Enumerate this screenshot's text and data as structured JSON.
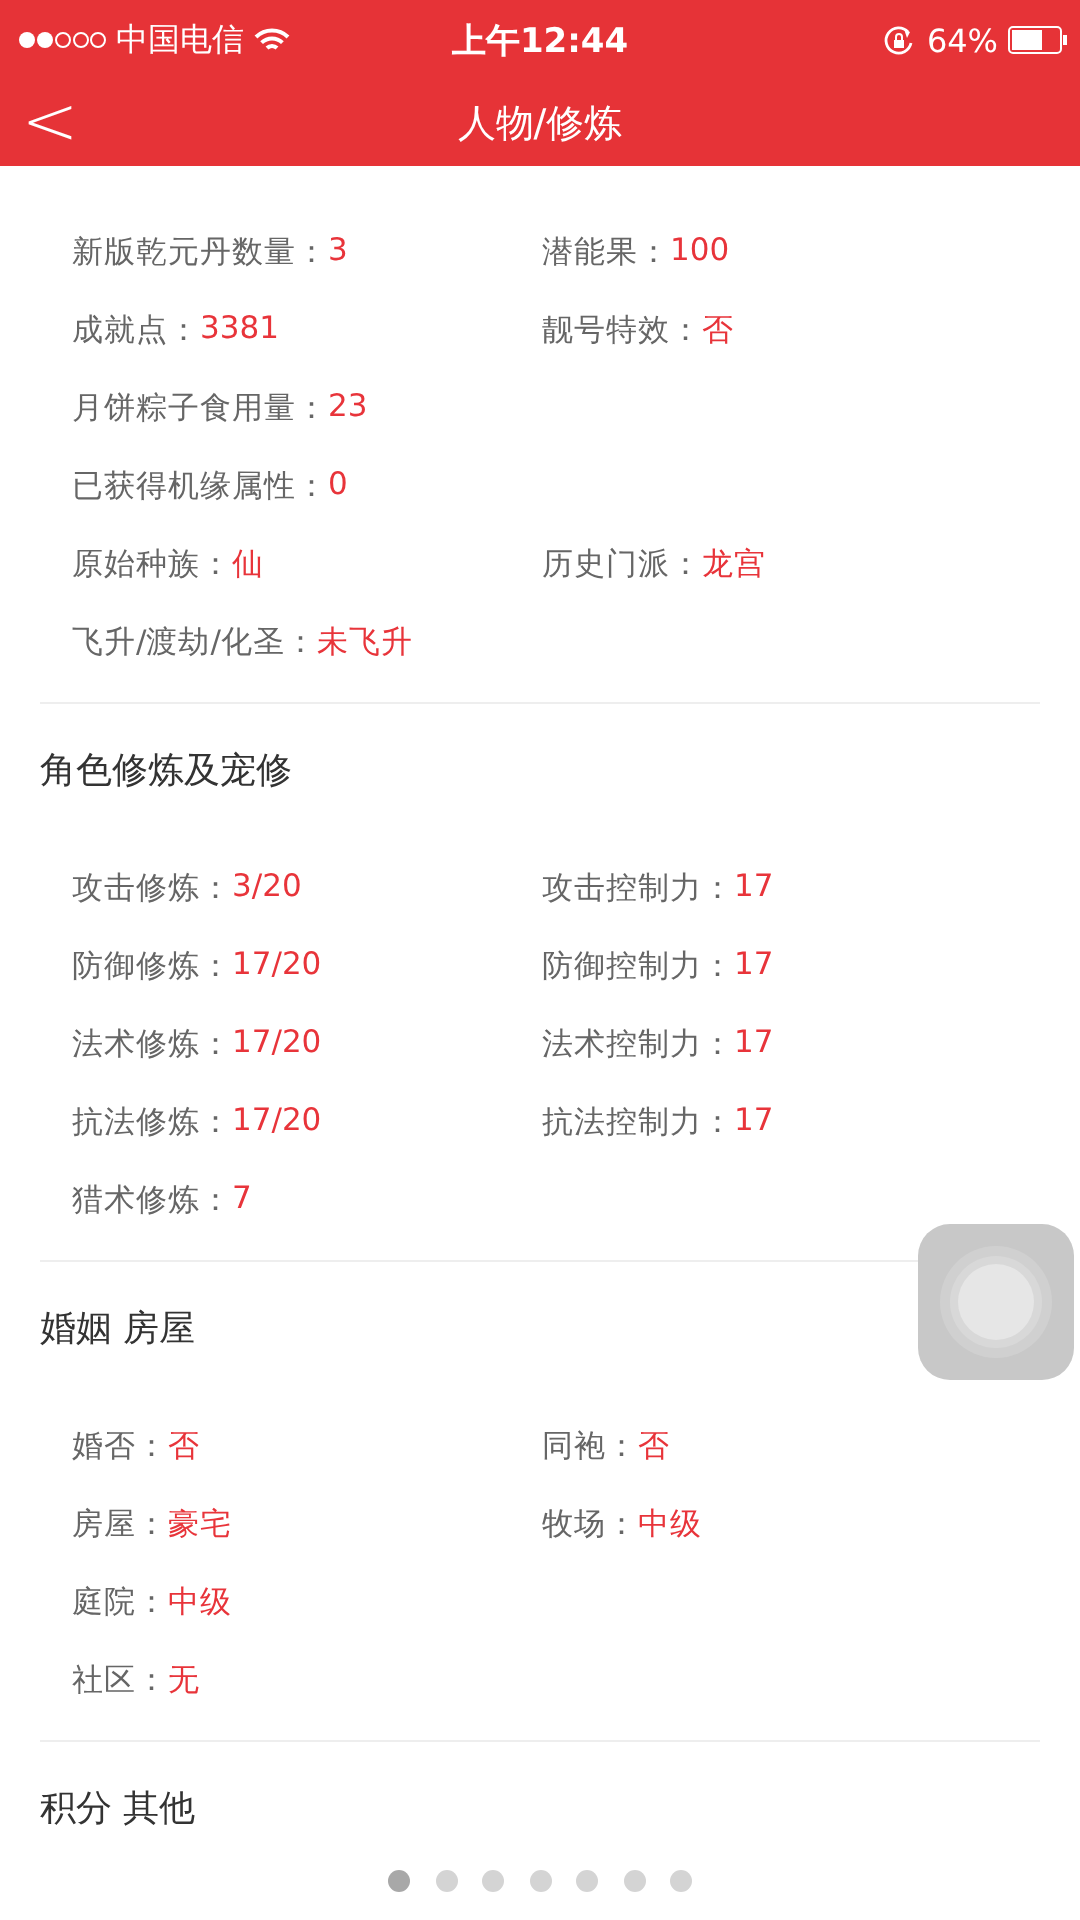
{
  "status_bar": {
    "carrier": "中国电信",
    "time": "上午12:44",
    "battery": "64%"
  },
  "nav": {
    "back": "<",
    "title": "人物/修炼"
  },
  "sections": [
    {
      "rows": [
        [
          {
            "label": "新版乾元丹数量：",
            "value": "3"
          },
          {
            "label": "潜能果：",
            "value": "100"
          }
        ],
        [
          {
            "label": "成就点：",
            "value": "3381"
          },
          {
            "label": "靓号特效：",
            "value": "否"
          }
        ],
        [
          {
            "label": "月饼粽子食用量：",
            "value": "23"
          }
        ],
        [
          {
            "label": "已获得机缘属性：",
            "value": "0"
          }
        ],
        [
          {
            "label": "原始种族：",
            "value": "仙"
          },
          {
            "label": "历史门派：",
            "value": "龙宫"
          }
        ],
        [
          {
            "label": "飞升/渡劫/化圣：",
            "value": "未飞升"
          }
        ]
      ]
    },
    {
      "title": "角色修炼及宠修",
      "rows": [
        [
          {
            "label": "攻击修炼：",
            "value": "3/20"
          },
          {
            "label": "攻击控制力：",
            "value": "17"
          }
        ],
        [
          {
            "label": "防御修炼：",
            "value": "17/20"
          },
          {
            "label": "防御控制力：",
            "value": "17"
          }
        ],
        [
          {
            "label": "法术修炼：",
            "value": "17/20"
          },
          {
            "label": "法术控制力：",
            "value": "17"
          }
        ],
        [
          {
            "label": "抗法修炼：",
            "value": "17/20"
          },
          {
            "label": "抗法控制力：",
            "value": "17"
          }
        ],
        [
          {
            "label": "猎术修炼：",
            "value": "7"
          }
        ]
      ]
    },
    {
      "title": "婚姻 房屋",
      "rows": [
        [
          {
            "label": "婚否：",
            "value": "否"
          },
          {
            "label": "同袍：",
            "value": "否"
          }
        ],
        [
          {
            "label": "房屋：",
            "value": "豪宅"
          },
          {
            "label": "牧场：",
            "value": "中级"
          }
        ],
        [
          {
            "label": "庭院：",
            "value": "中级"
          }
        ],
        [
          {
            "label": "社区：",
            "value": "无"
          }
        ]
      ]
    },
    {
      "title": "积分 其他"
    }
  ],
  "page_dots": [
    {
      "selected": true
    },
    {
      "selected": false
    },
    {
      "selected": false
    },
    {
      "selected": false
    },
    {
      "selected": false
    },
    {
      "selected": false
    },
    {
      "selected": false
    }
  ]
}
